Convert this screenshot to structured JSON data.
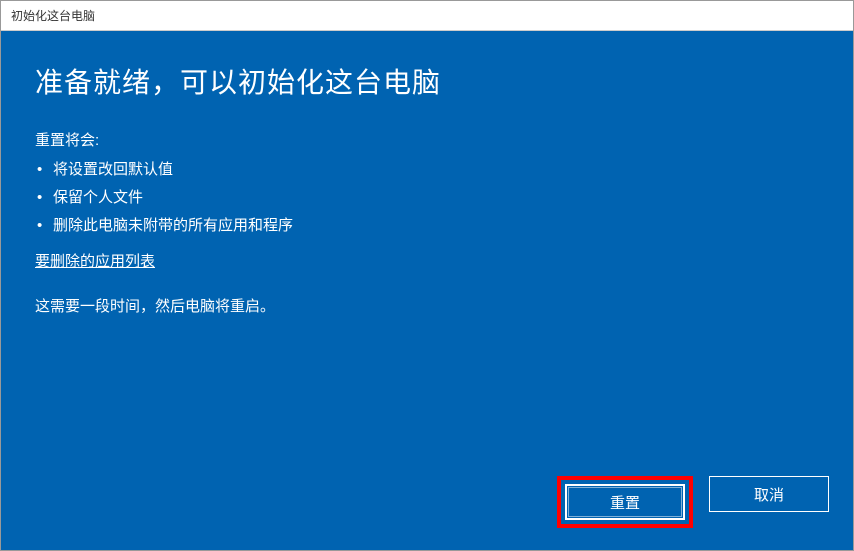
{
  "titlebar": {
    "title": "初始化这台电脑"
  },
  "main": {
    "heading": "准备就绪，可以初始化这台电脑",
    "subheading": "重置将会:",
    "bullets": [
      "将设置改回默认值",
      "保留个人文件",
      "删除此电脑未附带的所有应用和程序"
    ],
    "link": "要删除的应用列表",
    "note": "这需要一段时间，然后电脑将重启。"
  },
  "buttons": {
    "reset": "重置",
    "cancel": "取消"
  }
}
